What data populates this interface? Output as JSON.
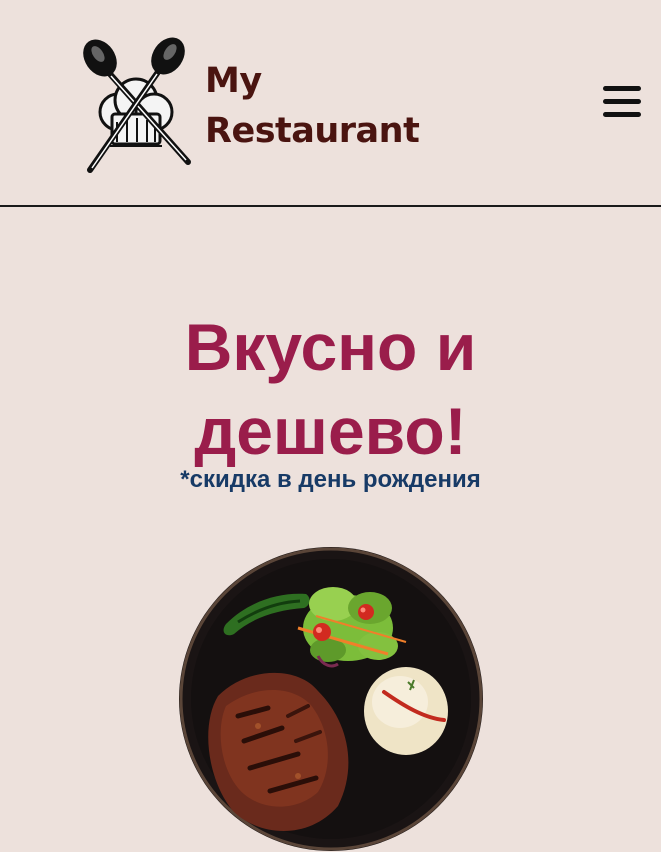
{
  "header": {
    "brand_line1": "My",
    "brand_line2": "Restaurant",
    "logo_icon": "crossed-spoons-chef-hat-icon",
    "menu_icon": "hamburger-menu-icon"
  },
  "hero": {
    "title_line1": "Вкусно и",
    "title_line2": "дешево!",
    "subtitle": "*скидка в день рождения"
  },
  "image": {
    "subject": "plate-of-grilled-meat-with-rice-and-salad"
  },
  "colors": {
    "background": "#ede1dc",
    "brand_text": "#4a1410",
    "title": "#9a1d4b",
    "subtitle": "#173a66"
  }
}
